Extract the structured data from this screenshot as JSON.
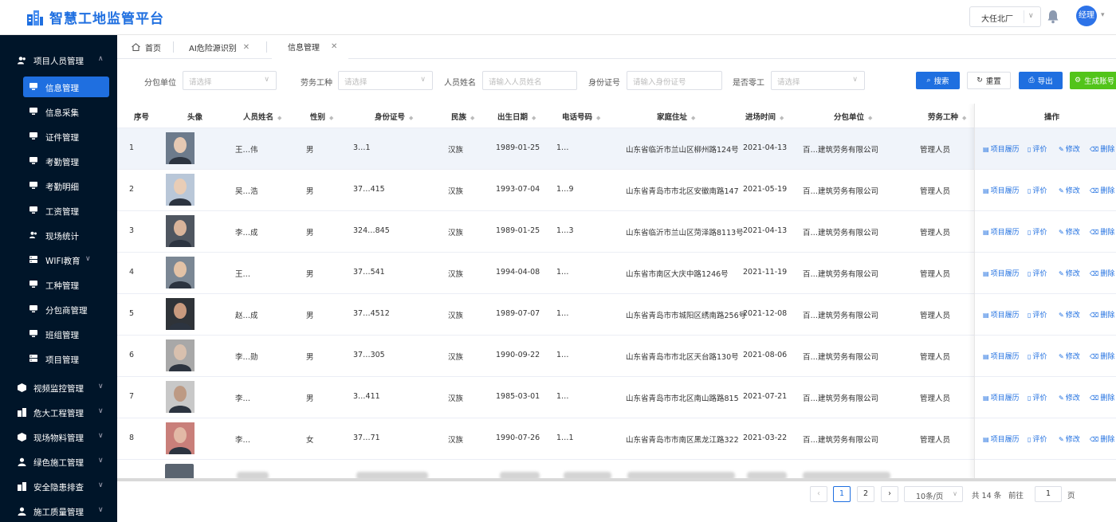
{
  "app": {
    "title": "智慧工地监管平台",
    "project": "大任北厂",
    "user_initials": "经理"
  },
  "sidebar": {
    "groups_top": [
      {
        "label": "项目人员管理"
      }
    ],
    "sub_items": [
      {
        "label": "信息管理",
        "active": true
      },
      {
        "label": "信息采集"
      },
      {
        "label": "证件管理"
      },
      {
        "label": "考勤管理"
      },
      {
        "label": "考勤明细"
      },
      {
        "label": "工资管理"
      },
      {
        "label": "现场统计"
      },
      {
        "label": "WIFI教育"
      },
      {
        "label": "工种管理"
      },
      {
        "label": "分包商管理"
      },
      {
        "label": "班组管理"
      },
      {
        "label": "项目管理"
      }
    ],
    "groups_bottom": [
      {
        "label": "视频监控管理"
      },
      {
        "label": "危大工程管理"
      },
      {
        "label": "现场物料管理"
      },
      {
        "label": "绿色施工管理"
      },
      {
        "label": "安全隐患排查"
      },
      {
        "label": "施工质量管理"
      }
    ]
  },
  "tabs": [
    {
      "label": "首页"
    },
    {
      "label": "AI危险源识别"
    },
    {
      "label": "信息管理"
    }
  ],
  "filters": {
    "subcontractor": {
      "label": "分包单位",
      "placeholder": "请选择"
    },
    "work_type": {
      "label": "劳务工种",
      "placeholder": "请选择"
    },
    "name": {
      "label": "人员姓名",
      "placeholder": "请输入人员姓名"
    },
    "id_card": {
      "label": "身份证号",
      "placeholder": "请输入身份证号"
    },
    "casual": {
      "label": "是否零工",
      "placeholder": "请选择"
    },
    "buttons": {
      "search": "搜索",
      "reset": "重置",
      "export": "导出",
      "generate": "生成账号"
    }
  },
  "table": {
    "columns": [
      "序号",
      "头像",
      "人员姓名",
      "性别",
      "身份证号",
      "民族",
      "出生日期",
      "电话号码",
      "家庭住址",
      "进场时间",
      "分包单位",
      "劳务工种",
      "操作"
    ],
    "actions": [
      "项目履历",
      "评价",
      "修改",
      "删除"
    ],
    "rows": [
      {
        "no": "1",
        "name": "王…伟",
        "gender": "男",
        "id": "3…1",
        "nation": "汉族",
        "birth": "1989-01-25",
        "phone": "1…",
        "address": "山东省临沂市兰山区柳州路124号",
        "entry": "2021-04-13",
        "unit": "百…建筑劳务有限公司",
        "worktype": "管理人员"
      },
      {
        "no": "2",
        "name": "吴…浩",
        "gender": "男",
        "id": "37…415",
        "nation": "汉族",
        "birth": "1993-07-04",
        "phone": "1…9",
        "address": "山东省青岛市市北区安徽南路147",
        "entry": "2021-05-19",
        "unit": "百…建筑劳务有限公司",
        "worktype": "管理人员"
      },
      {
        "no": "3",
        "name": "李…成",
        "gender": "男",
        "id": "324…845",
        "nation": "汉族",
        "birth": "1989-01-25",
        "phone": "1…3",
        "address": "山东省临沂市兰山区菏泽路8113号",
        "entry": "2021-04-13",
        "unit": "百…建筑劳务有限公司",
        "worktype": "管理人员"
      },
      {
        "no": "4",
        "name": "王…",
        "gender": "男",
        "id": "37…541",
        "nation": "汉族",
        "birth": "1994-04-08",
        "phone": "1…",
        "address": "山东省市南区大庆中路1246号",
        "entry": "2021-11-19",
        "unit": "百…建筑劳务有限公司",
        "worktype": "管理人员"
      },
      {
        "no": "5",
        "name": "赵…成",
        "gender": "男",
        "id": "37…4512",
        "nation": "汉族",
        "birth": "1989-07-07",
        "phone": "1…",
        "address": "山东省青岛市市城阳区绣南路256号",
        "entry": "2021-12-08",
        "unit": "百…建筑劳务有限公司",
        "worktype": "管理人员"
      },
      {
        "no": "6",
        "name": "李…勋",
        "gender": "男",
        "id": "37…305",
        "nation": "汉族",
        "birth": "1990-09-22",
        "phone": "1…",
        "address": "山东省青岛市市北区天台路130号",
        "entry": "2021-08-06",
        "unit": "百…建筑劳务有限公司",
        "worktype": "管理人员"
      },
      {
        "no": "7",
        "name": "李…",
        "gender": "男",
        "id": "3…411",
        "nation": "汉族",
        "birth": "1985-03-01",
        "phone": "1…",
        "address": "山东省青岛市市北区南山路路815",
        "entry": "2021-07-21",
        "unit": "百…建筑劳务有限公司",
        "worktype": "管理人员"
      },
      {
        "no": "8",
        "name": "李…",
        "gender": "女",
        "id": "37…71",
        "nation": "汉族",
        "birth": "1990-07-26",
        "phone": "1…1",
        "address": "山东省青岛市市南区黑龙江路322",
        "entry": "2021-03-22",
        "unit": "百…建筑劳务有限公司",
        "worktype": "管理人员"
      }
    ]
  },
  "pagination": {
    "prev": "‹",
    "next": "›",
    "pages": [
      "1",
      "2"
    ],
    "current": "1",
    "page_size": "10条/页",
    "total": "共 14 条",
    "goto_label": "前往",
    "goto_value": "1",
    "page_unit": "页"
  },
  "colors": {
    "brand": "#1f6fe0",
    "sidebar_bg": "#001529",
    "success": "#52c41a"
  }
}
